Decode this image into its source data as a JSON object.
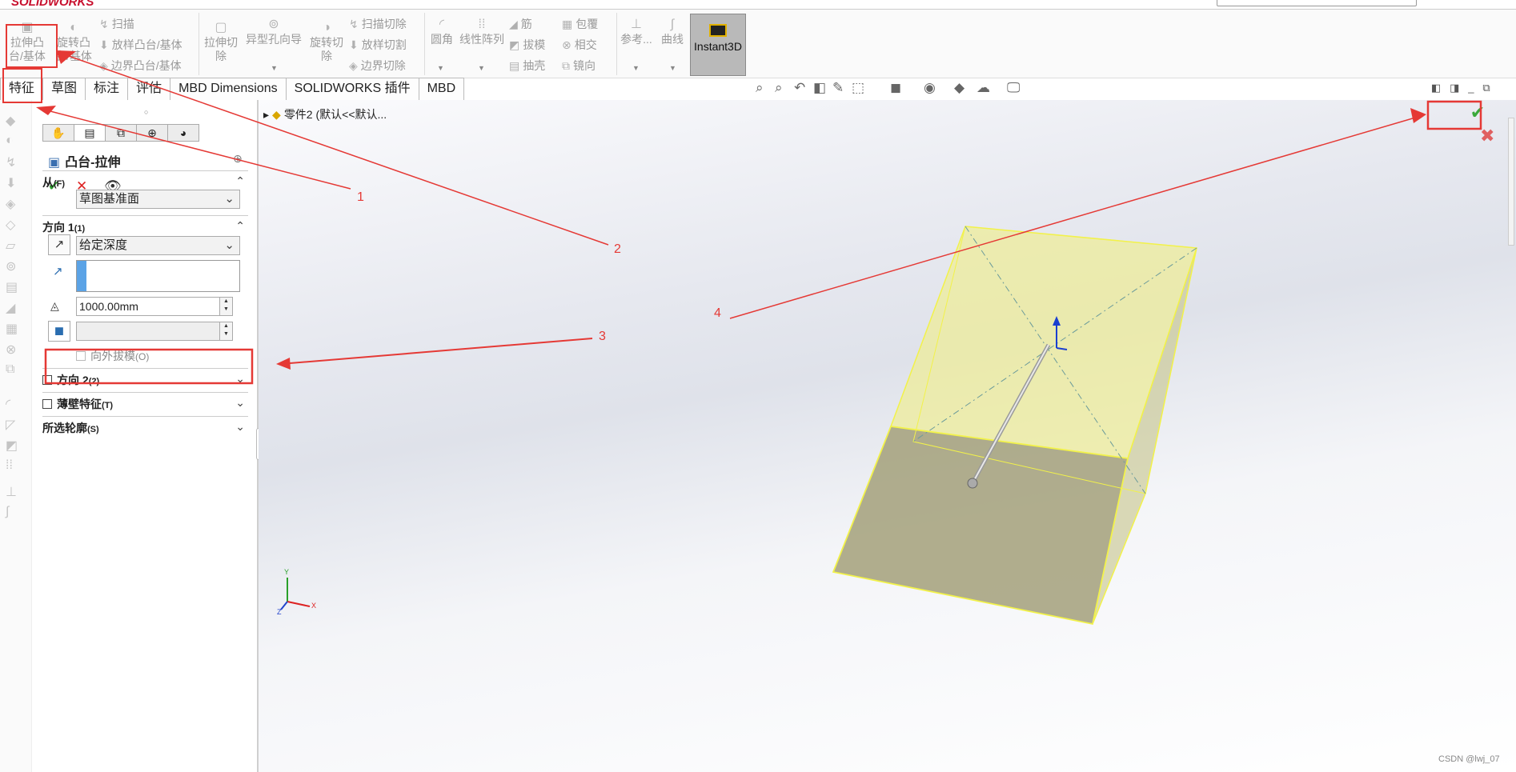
{
  "app": {
    "logo": "SOLIDWORKS"
  },
  "ribbon": {
    "extrude_boss_label": "拉伸凸\n台/基体",
    "revolve_boss_label": "旋转凸\n台/基体",
    "sweep_label": "扫描",
    "loft_label": "放样凸台/基体",
    "boundary_label": "边界凸台/基体",
    "extrude_cut_label": "拉伸切\n除",
    "hole_wizard_label": "异型孔向导",
    "revolve_cut_label": "旋转切\n除",
    "swept_cut_label": "扫描切除",
    "lofted_cut_label": "放样切割",
    "boundary_cut_label": "边界切除",
    "fillet_label": "圆角",
    "linear_pattern_label": "线性阵列",
    "rib_label": "筋",
    "draft_label": "拔模",
    "shell_label": "抽壳",
    "wrap_label": "包覆",
    "intersect_label": "相交",
    "mirror_label": "镜向",
    "reference_label": "参考...",
    "curves_label": "曲线",
    "instant3d_label": "Instant3D"
  },
  "tabs": [
    "特征",
    "草图",
    "标注",
    "评估",
    "MBD Dimensions",
    "SOLIDWORKS 插件",
    "MBD"
  ],
  "property_manager": {
    "title": "凸台-拉伸",
    "from_section": {
      "label": "从",
      "hotkey": "(F)",
      "value": "草图基准面"
    },
    "direction1_section": {
      "label": "方向 1",
      "hotkey": "(1)",
      "end_condition": "给定深度",
      "depth": "1000.00mm",
      "draft_outward": "向外拔模",
      "draft_hotkey": "(O)"
    },
    "direction2_section": {
      "label": "方向 2",
      "hotkey": "(2)"
    },
    "thin_feature_section": {
      "label": "薄壁特征",
      "hotkey": "(T)"
    },
    "selected_contours_section": {
      "label": "所选轮廓",
      "hotkey": "(S)"
    }
  },
  "feature_tree": {
    "root": "零件2  (默认<<默认..."
  },
  "triad": {
    "x": "X",
    "y": "Y",
    "z": "Z"
  },
  "annotations": [
    "1",
    "2",
    "3",
    "4"
  ],
  "watermark": "CSDN @lwj_07",
  "colors": {
    "annotation": "#e53935",
    "extrude_preview": "#d8d860",
    "confirm_green": "#3aa93a",
    "cancel_red": "#e06060"
  }
}
